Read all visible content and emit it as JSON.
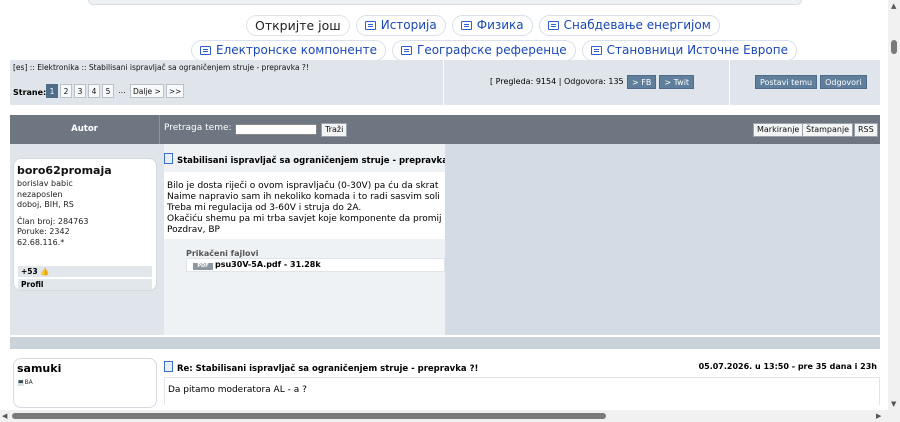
{
  "discover": {
    "label": "Откријте још",
    "row1": [
      "Историја",
      "Физика",
      "Снабдевање енергијом"
    ],
    "row2": [
      "Електронске компоненте",
      "Географске референце",
      "Становници Источне Европе"
    ]
  },
  "header": {
    "breadcrumb": "[es] :: Elektronika :: Stabilisani ispravljač sa ograničenjem struje - prepravka ?!",
    "pages_label": "Strane:",
    "pages": [
      "1",
      "2",
      "3",
      "4",
      "5",
      "...",
      "Dalje >",
      ">>"
    ],
    "stats": "[ Pregleda: 9154 | Odgovora: 135 ]",
    "fb": "> FB",
    "twit": "> Twit",
    "new_topic": "Postavi temu",
    "reply": "Odgovori"
  },
  "bar": {
    "author": "Autor",
    "search_label": "Pretraga teme:",
    "search_button": "Traži",
    "mark": "Markiranje",
    "print": "Štampanje",
    "rss": "RSS"
  },
  "post1": {
    "username": "boro62promaja",
    "info": [
      "borislav babic",
      "nezaposlen",
      "doboj, BIH, RS",
      "",
      "Član broj: 284763",
      "Poruke: 2342",
      "62.68.116.*"
    ],
    "reputation": "+53",
    "profile": "Profil",
    "title": "Stabilisani ispravljač sa ograničenjem struje - prepravka",
    "lines": [
      "Bilo je dosta riječi o ovom ispravljaču (0-30V) pa ću da skrat",
      "Naime napravio sam ih nekoliko komada i to radi sasvim soli",
      "Treba mi regulacija od 3-60V i struja do 2A.",
      "Okačiću shemu pa mi trba savjet koje komponente da promij",
      "Pozdrav, BP"
    ],
    "attachments_label": "Prikačeni fajlovi",
    "attachment": "psu30V-5A.pdf - 31.28k"
  },
  "post2": {
    "username": "samuki",
    "flag": "BA",
    "title": "Re: Stabilisani ispravljač sa ograničenjem struje - prepravka ?!",
    "date": "05.07.2026. u 13:50 - pre 35 dana i 23h",
    "text": "Da pitamo moderatora AL - a ?"
  }
}
